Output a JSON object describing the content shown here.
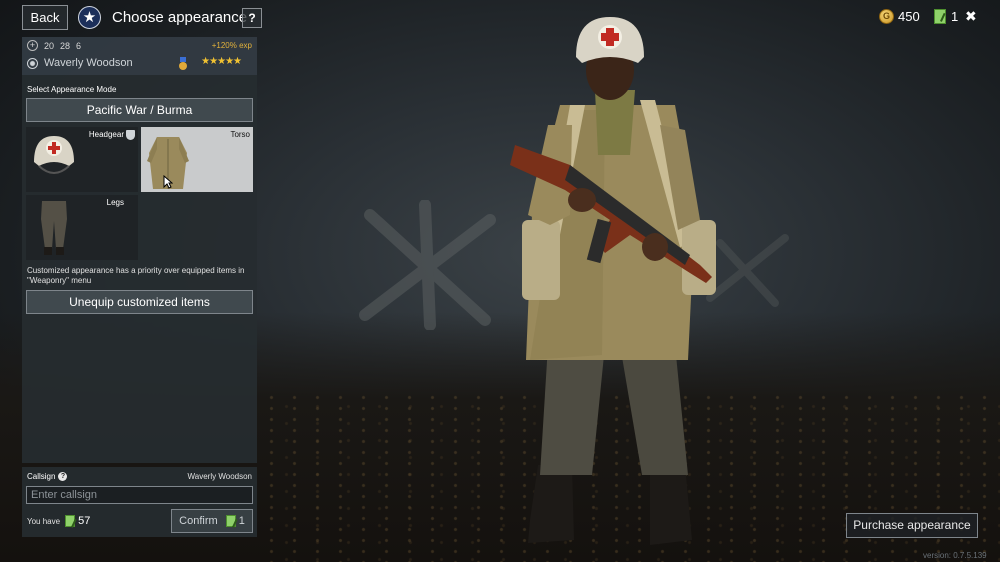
{
  "header": {
    "back_label": "Back",
    "title": "Choose appearance",
    "help_label": "?",
    "gold": "450",
    "tickets": "1",
    "close_icon": "close-icon"
  },
  "soldier": {
    "stats": [
      "20",
      "28",
      "6"
    ],
    "exp_bonus": "+120% exp",
    "name": "Waverly Woodson",
    "stars": "★★★★★"
  },
  "appearance": {
    "section_label": "Select Appearance Mode",
    "mode_button": "Pacific War / Burma",
    "slots": [
      {
        "label": "Headgear",
        "icon": "helmet-icon",
        "selected": false
      },
      {
        "label": "Torso",
        "icon": "coat-icon",
        "selected": true
      },
      {
        "label": "Legs",
        "icon": "trousers-icon",
        "selected": false
      }
    ],
    "info_text": "Customized appearance has a priority over equipped items in \"Weaponry\" menu",
    "unequip_label": "Unequip customized items"
  },
  "callsign": {
    "label": "Callsign",
    "current_name": "Waverly Woodson",
    "placeholder": "Enter callsign",
    "you_have_label": "You have",
    "you_have_count": "57",
    "confirm_label": "Confirm",
    "confirm_cost": "1"
  },
  "footer": {
    "purchase_label": "Purchase appearance",
    "version": "version: 0.7.5.139"
  },
  "colors": {
    "accent_gold": "#e2b23b",
    "star_yellow": "#f1c232",
    "ticket_green": "#8fd16a",
    "panel_bg": "#262c30"
  }
}
